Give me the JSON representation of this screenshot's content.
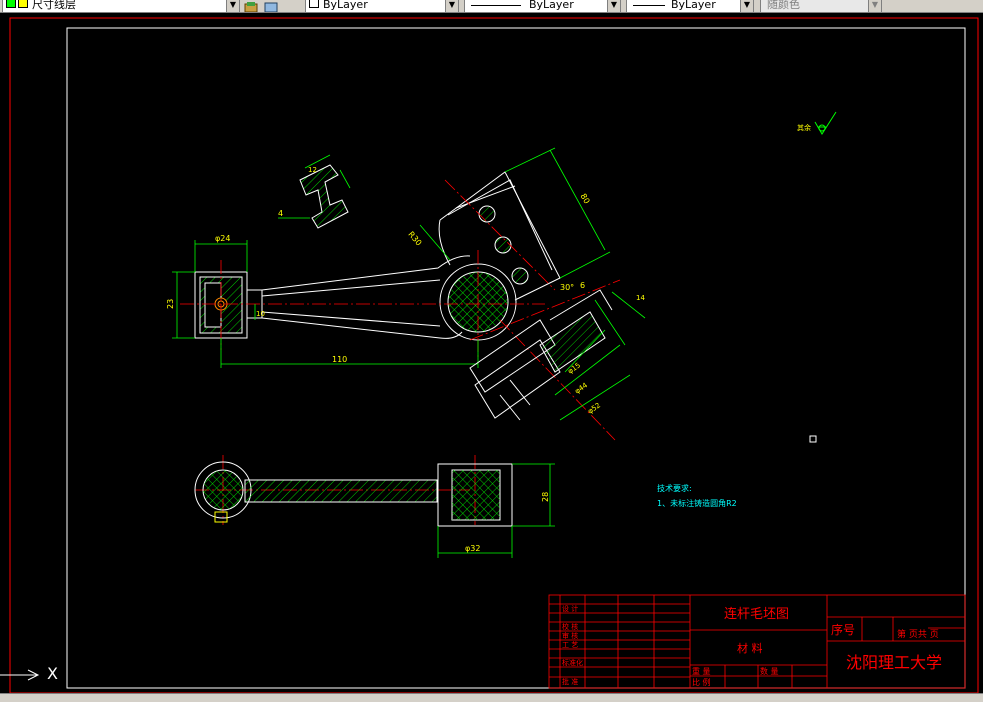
{
  "toolbar": {
    "layer_name": "尺寸线层",
    "color_value": "ByLayer",
    "linetype_value": "ByLayer",
    "lineweight_value": "ByLayer",
    "plotstyle_value": "随颜色"
  },
  "drawing": {
    "dim_width_top": "φ24",
    "dim_height_left": "23",
    "dim_inner": "10",
    "dim_length": "110",
    "dim_bolt_angle": "R30",
    "dim_tilt": "30°",
    "dim_6": "6",
    "dim_15": "φ15",
    "dim_44": "φ44",
    "dim_52": "φ52",
    "dim_80": "80",
    "dim_14": "14",
    "dim_4": "4",
    "dim_12": "12",
    "dim_bottom_width": "φ32",
    "dim_bottom_height": "28",
    "roughness_label": "其余",
    "tech_title": "技术要求:",
    "tech_item1": "1、未标注铸造圆角R2"
  },
  "title_block": {
    "part_name": "连杆毛坯图",
    "material_label": "材    料",
    "seq_label": "序号",
    "school": "沈阳理工大学",
    "sheet_label": "第  页共  页",
    "row_labels": [
      "设 计",
      "校 核",
      "审 核",
      "工 艺",
      "标准化",
      "批 准"
    ],
    "scale_label": "重 量",
    "ratio_label": "比 例",
    "qty_label": "数 量"
  },
  "colors": {
    "bg": "#000000",
    "frame": "#ffffff",
    "red": "#ff0000",
    "green": "#00ff00",
    "yellow": "#ffff00",
    "cyan": "#00ffff",
    "white": "#ffffff"
  }
}
